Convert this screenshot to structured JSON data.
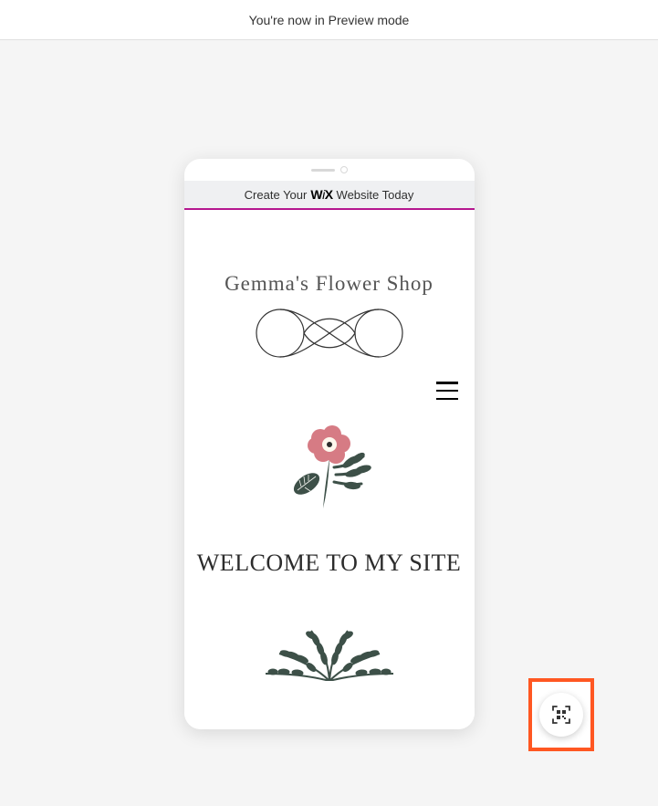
{
  "topbar": {
    "message": "You're now in Preview mode"
  },
  "wix_banner": {
    "prefix": "Create Your",
    "logo": "WiX",
    "suffix": "Website Today"
  },
  "site": {
    "title": "Gemma's Flower Shop",
    "welcome": "Welcome to My Site"
  }
}
